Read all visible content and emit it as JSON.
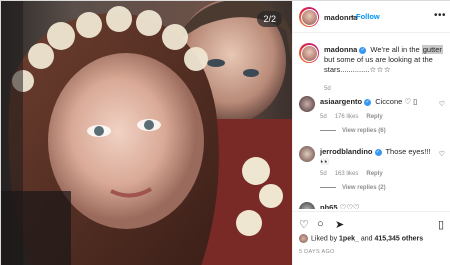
{
  "photo": {
    "counter": "2/2"
  },
  "header": {
    "username": "madonna",
    "dot": "•",
    "follow_label": "Follow",
    "more_icon": "•••"
  },
  "caption": {
    "username": "madonna",
    "text_before": " We're all in the ",
    "highlight": "gutter",
    "text_after": " but some of us are looking at the stars..............",
    "stars": "☆☆☆",
    "timestamp": "5d"
  },
  "comments": [
    {
      "username": "asiaargento",
      "text": " Ciccone ",
      "emoji": "♡ ▯",
      "time": "5d",
      "likes": "176 likes",
      "reply": "Reply",
      "view_replies": "View replies (6)"
    },
    {
      "username": "jerrodblandino",
      "text": " Those eyes!!!",
      "emoji": "👀",
      "time": "5d",
      "likes": "163 likes",
      "reply": "Reply",
      "view_replies": "View replies (2)"
    },
    {
      "username": "ph65",
      "text": " ♡♡♡",
      "emoji": ""
    }
  ],
  "actions": {
    "like_icon": "♡",
    "comment_icon": "○",
    "share_icon": "➤",
    "save_icon": "▯"
  },
  "likes": {
    "prefix": "Liked by ",
    "user": "1pek_",
    "middle": " and ",
    "others": "415,345 others"
  },
  "posted": "5 DAYS AGO",
  "colors": {
    "accent": "#0095f6",
    "verified": "#3897f0",
    "muted": "#8e8e8e",
    "text": "#262626"
  }
}
